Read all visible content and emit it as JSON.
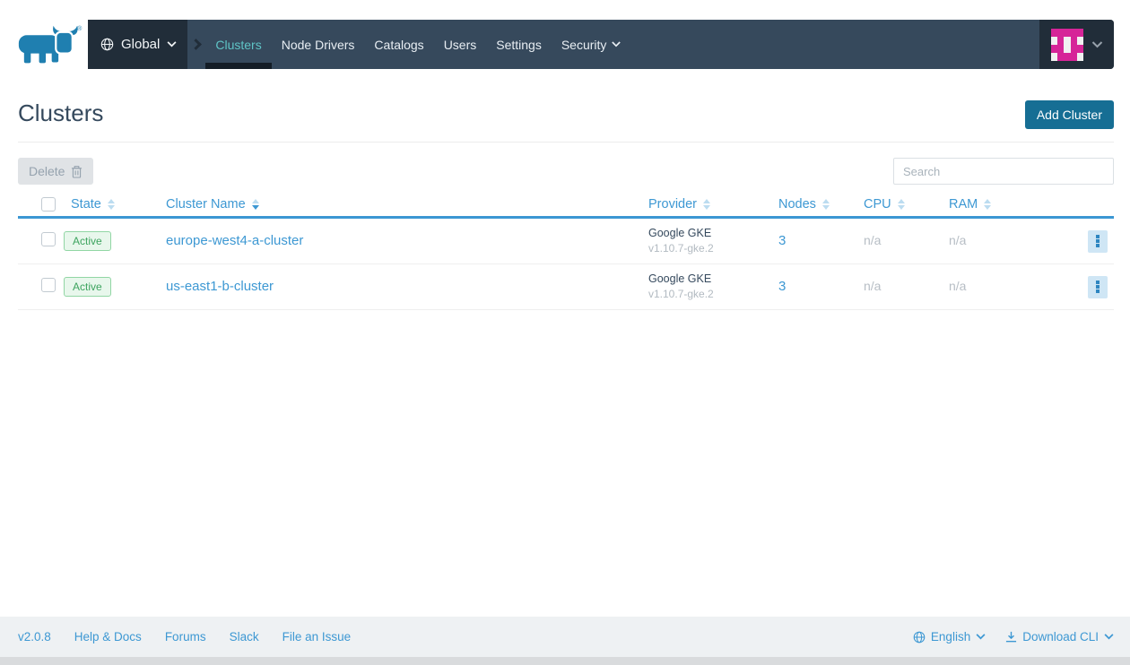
{
  "nav": {
    "environment": "Global",
    "items": [
      {
        "label": "Clusters",
        "active": true
      },
      {
        "label": "Node Drivers",
        "active": false
      },
      {
        "label": "Catalogs",
        "active": false
      },
      {
        "label": "Users",
        "active": false
      },
      {
        "label": "Settings",
        "active": false
      },
      {
        "label": "Security",
        "active": false,
        "has_dropdown": true
      }
    ]
  },
  "page": {
    "title": "Clusters",
    "add_button": "Add Cluster",
    "delete_button": "Delete",
    "search_placeholder": "Search"
  },
  "table": {
    "columns": [
      "State",
      "Cluster Name",
      "Provider",
      "Nodes",
      "CPU",
      "RAM"
    ],
    "sorted_column": "Cluster Name",
    "rows": [
      {
        "state": "Active",
        "name": "europe-west4-a-cluster",
        "provider": "Google GKE",
        "provider_version": "v1.10.7-gke.2",
        "nodes": "3",
        "cpu": "n/a",
        "ram": "n/a"
      },
      {
        "state": "Active",
        "name": "us-east1-b-cluster",
        "provider": "Google GKE",
        "provider_version": "v1.10.7-gke.2",
        "nodes": "3",
        "cpu": "n/a",
        "ram": "n/a"
      }
    ]
  },
  "footer": {
    "version": "v2.0.8",
    "links": [
      "Help & Docs",
      "Forums",
      "Slack",
      "File an Issue"
    ],
    "language": "English",
    "download": "Download CLI"
  },
  "colors": {
    "accent_blue": "#3d98d3",
    "navbar": "#36495c",
    "navbar_dark": "#212d39",
    "active_teal": "#5fc4c6",
    "primary_button": "#166e94",
    "badge_green": "#3da45f",
    "avatar_magenta": "#d62598",
    "logo_blue": "#1f7fb0"
  }
}
